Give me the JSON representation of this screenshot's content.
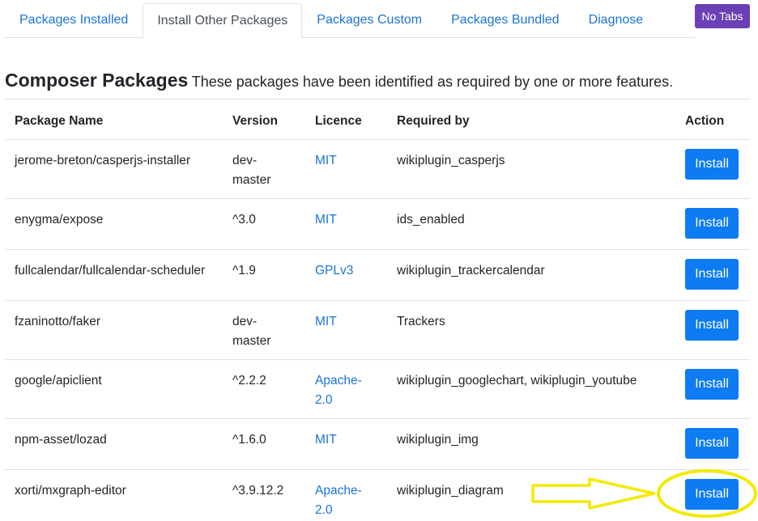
{
  "tabs": [
    {
      "label": "Packages Installed",
      "active": false
    },
    {
      "label": "Install Other Packages",
      "active": true
    },
    {
      "label": "Packages Custom",
      "active": false
    },
    {
      "label": "Packages Bundled",
      "active": false
    },
    {
      "label": "Diagnose",
      "active": false
    }
  ],
  "no_tabs_label": "No Tabs",
  "section": {
    "title": "Composer Packages",
    "description": "These packages have been identified as required by one or more features."
  },
  "table": {
    "headers": {
      "name": "Package Name",
      "version": "Version",
      "licence": "Licence",
      "required_by": "Required by",
      "action": "Action"
    },
    "rows": [
      {
        "name": "jerome-breton/casperjs-installer",
        "version": "dev-master",
        "licence": "MIT",
        "required_by": "wikiplugin_casperjs",
        "action": "Install"
      },
      {
        "name": "enygma/expose",
        "version": "^3.0",
        "licence": "MIT",
        "required_by": "ids_enabled",
        "action": "Install"
      },
      {
        "name": "fullcalendar/fullcalendar-scheduler",
        "version": "^1.9",
        "licence": "GPLv3",
        "required_by": "wikiplugin_trackercalendar",
        "action": "Install"
      },
      {
        "name": "fzaninotto/faker",
        "version": "dev-master",
        "licence": "MIT",
        "required_by": "Trackers",
        "action": "Install"
      },
      {
        "name": "google/apiclient",
        "version": "^2.2.2",
        "licence": "Apache-2.0",
        "required_by": "wikiplugin_googlechart, wikiplugin_youtube",
        "action": "Install"
      },
      {
        "name": "npm-asset/lozad",
        "version": "^1.6.0",
        "licence": "MIT",
        "required_by": "wikiplugin_img",
        "action": "Install"
      },
      {
        "name": "xorti/mxgraph-editor",
        "version": "^3.9.12.2",
        "licence": "Apache-2.0",
        "required_by": "wikiplugin_diagram",
        "action": "Install"
      }
    ]
  },
  "colors": {
    "link": "#1a73d9",
    "primary_button": "#0d7bf2",
    "no_tabs_button": "#6b3fb5",
    "annotation": "#f2ea00"
  },
  "annotation_icon": "yellow-arrow-and-circle"
}
